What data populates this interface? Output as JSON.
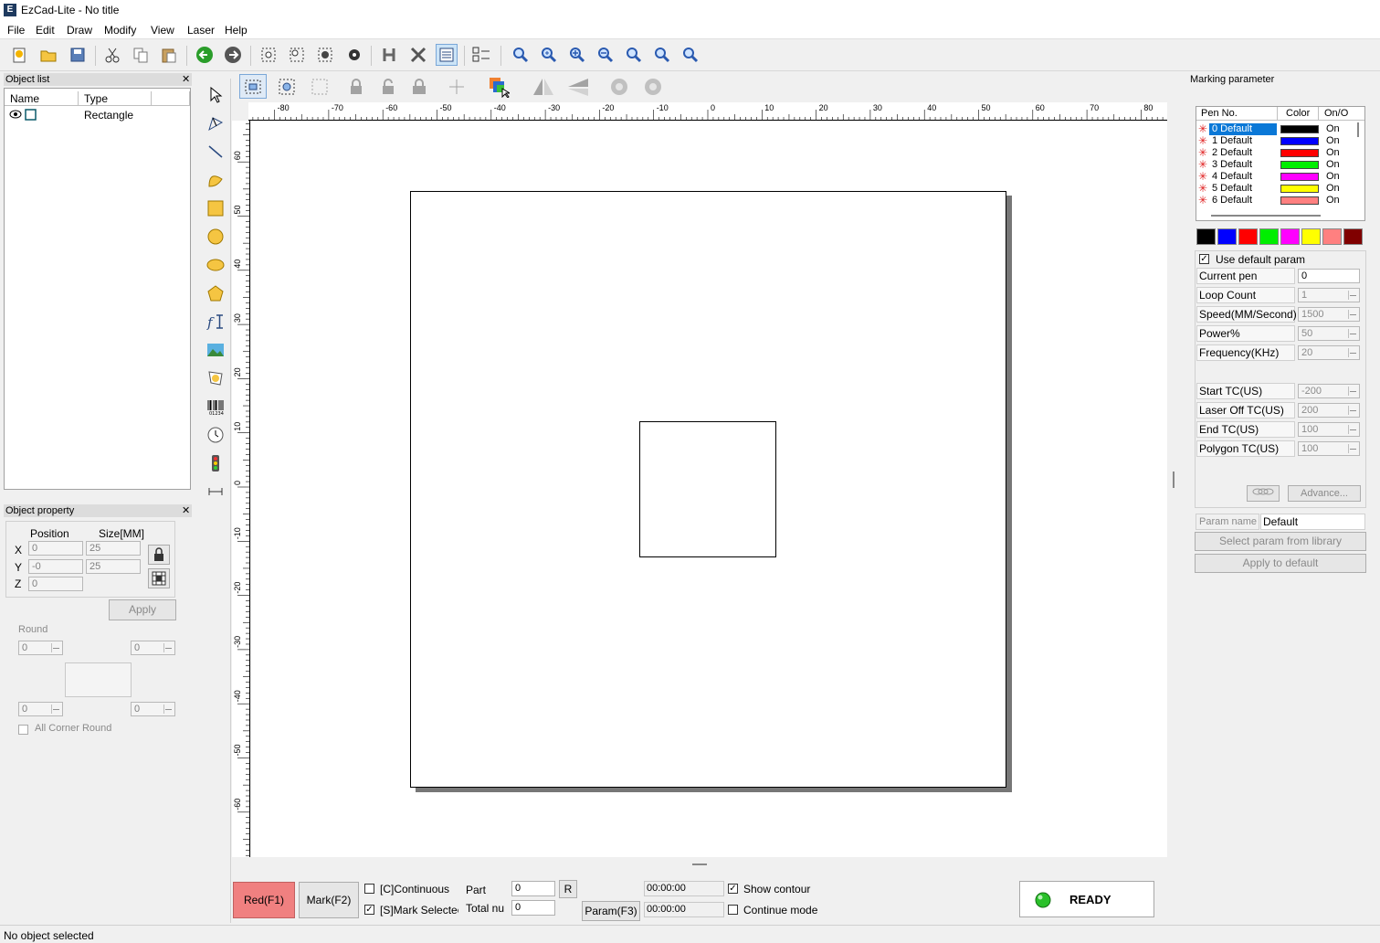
{
  "window": {
    "title": "EzCad-Lite - No title",
    "icon": "app-icon"
  },
  "menu": [
    "File",
    "Edit",
    "Draw",
    "Modify",
    "View",
    "Laser",
    "Help"
  ],
  "object_list": {
    "title": "Object list",
    "columns": [
      "Name",
      "Type"
    ],
    "rows": [
      {
        "name_icon": "eye-icon",
        "type": "Rectangle"
      }
    ]
  },
  "object_property": {
    "title": "Object property",
    "position_label": "Position",
    "size_label": "Size[MM]",
    "x_label": "X",
    "y_label": "Y",
    "z_label": "Z",
    "x_pos": "0",
    "x_size": "25",
    "y_pos": "-0",
    "y_size": "25",
    "z_pos": "0",
    "apply_label": "Apply",
    "round_label": "Round",
    "round_tl": "0",
    "round_tr": "0",
    "round_bl": "0",
    "round_br": "0",
    "all_corner_round_label": "All Corner Round"
  },
  "ruler": {
    "top_labels": [
      "-80",
      "-70",
      "-60",
      "-50",
      "-40",
      "-30",
      "-20",
      "-10",
      "0",
      "10",
      "20",
      "30",
      "40",
      "50",
      "60",
      "70",
      "80"
    ],
    "left_labels": [
      "60",
      "50",
      "40",
      "30",
      "20",
      "10",
      "0",
      "-10",
      "-20",
      "-30",
      "-40",
      "-50",
      "-60"
    ]
  },
  "marking": {
    "title": "Marking parameter",
    "table_headers": [
      "Pen No.",
      "Color",
      "On/O"
    ],
    "pens": [
      {
        "no": "0 Default",
        "color": "#000000",
        "on": "On"
      },
      {
        "no": "1 Default",
        "color": "#0000ff",
        "on": "On"
      },
      {
        "no": "2 Default",
        "color": "#ff0000",
        "on": "On"
      },
      {
        "no": "3 Default",
        "color": "#00ee00",
        "on": "On"
      },
      {
        "no": "4 Default",
        "color": "#ff00ff",
        "on": "On"
      },
      {
        "no": "5 Default",
        "color": "#ffff00",
        "on": "On"
      },
      {
        "no": "6 Default",
        "color": "#ff8080",
        "on": "On"
      }
    ],
    "palette": [
      "#000000",
      "#0000ff",
      "#ff0000",
      "#00ee00",
      "#ff00ff",
      "#ffff00",
      "#ff8080",
      "#800000"
    ],
    "use_default_label": "Use default param",
    "current_pen_label": "Current pen",
    "current_pen": "0",
    "params": [
      {
        "label": "Loop Count",
        "value": "1"
      },
      {
        "label": "Speed(MM/Second)",
        "value": "1500"
      },
      {
        "label": "Power%",
        "value": "50"
      },
      {
        "label": "Frequency(KHz)",
        "value": "20"
      }
    ],
    "tc_params": [
      {
        "label": "Start TC(US)",
        "value": "-200"
      },
      {
        "label": "Laser Off TC(US)",
        "value": "200"
      },
      {
        "label": "End TC(US)",
        "value": "100"
      },
      {
        "label": "Polygon TC(US)",
        "value": "100"
      }
    ],
    "advance_label": "Advance...",
    "param_name_label": "Param name",
    "param_name": "Default",
    "select_lib_label": "Select param from library",
    "apply_default_label": "Apply to default"
  },
  "bottom": {
    "red_label": "Red(F1)",
    "mark_label": "Mark(F2)",
    "continuous_label": "[C]Continuous",
    "mark_selected_label": "[S]Mark Selectec",
    "part_label": "Part",
    "total_label": "Total nu",
    "part_value": "0",
    "total_value": "0",
    "r_label": "R",
    "param_label": "Param(F3)",
    "time1": "00:00:00",
    "time2": "00:00:00",
    "show_contour_label": "Show contour",
    "continue_mode_label": "Continue mode",
    "ready_label": "READY"
  },
  "status": {
    "text": "No object selected"
  }
}
